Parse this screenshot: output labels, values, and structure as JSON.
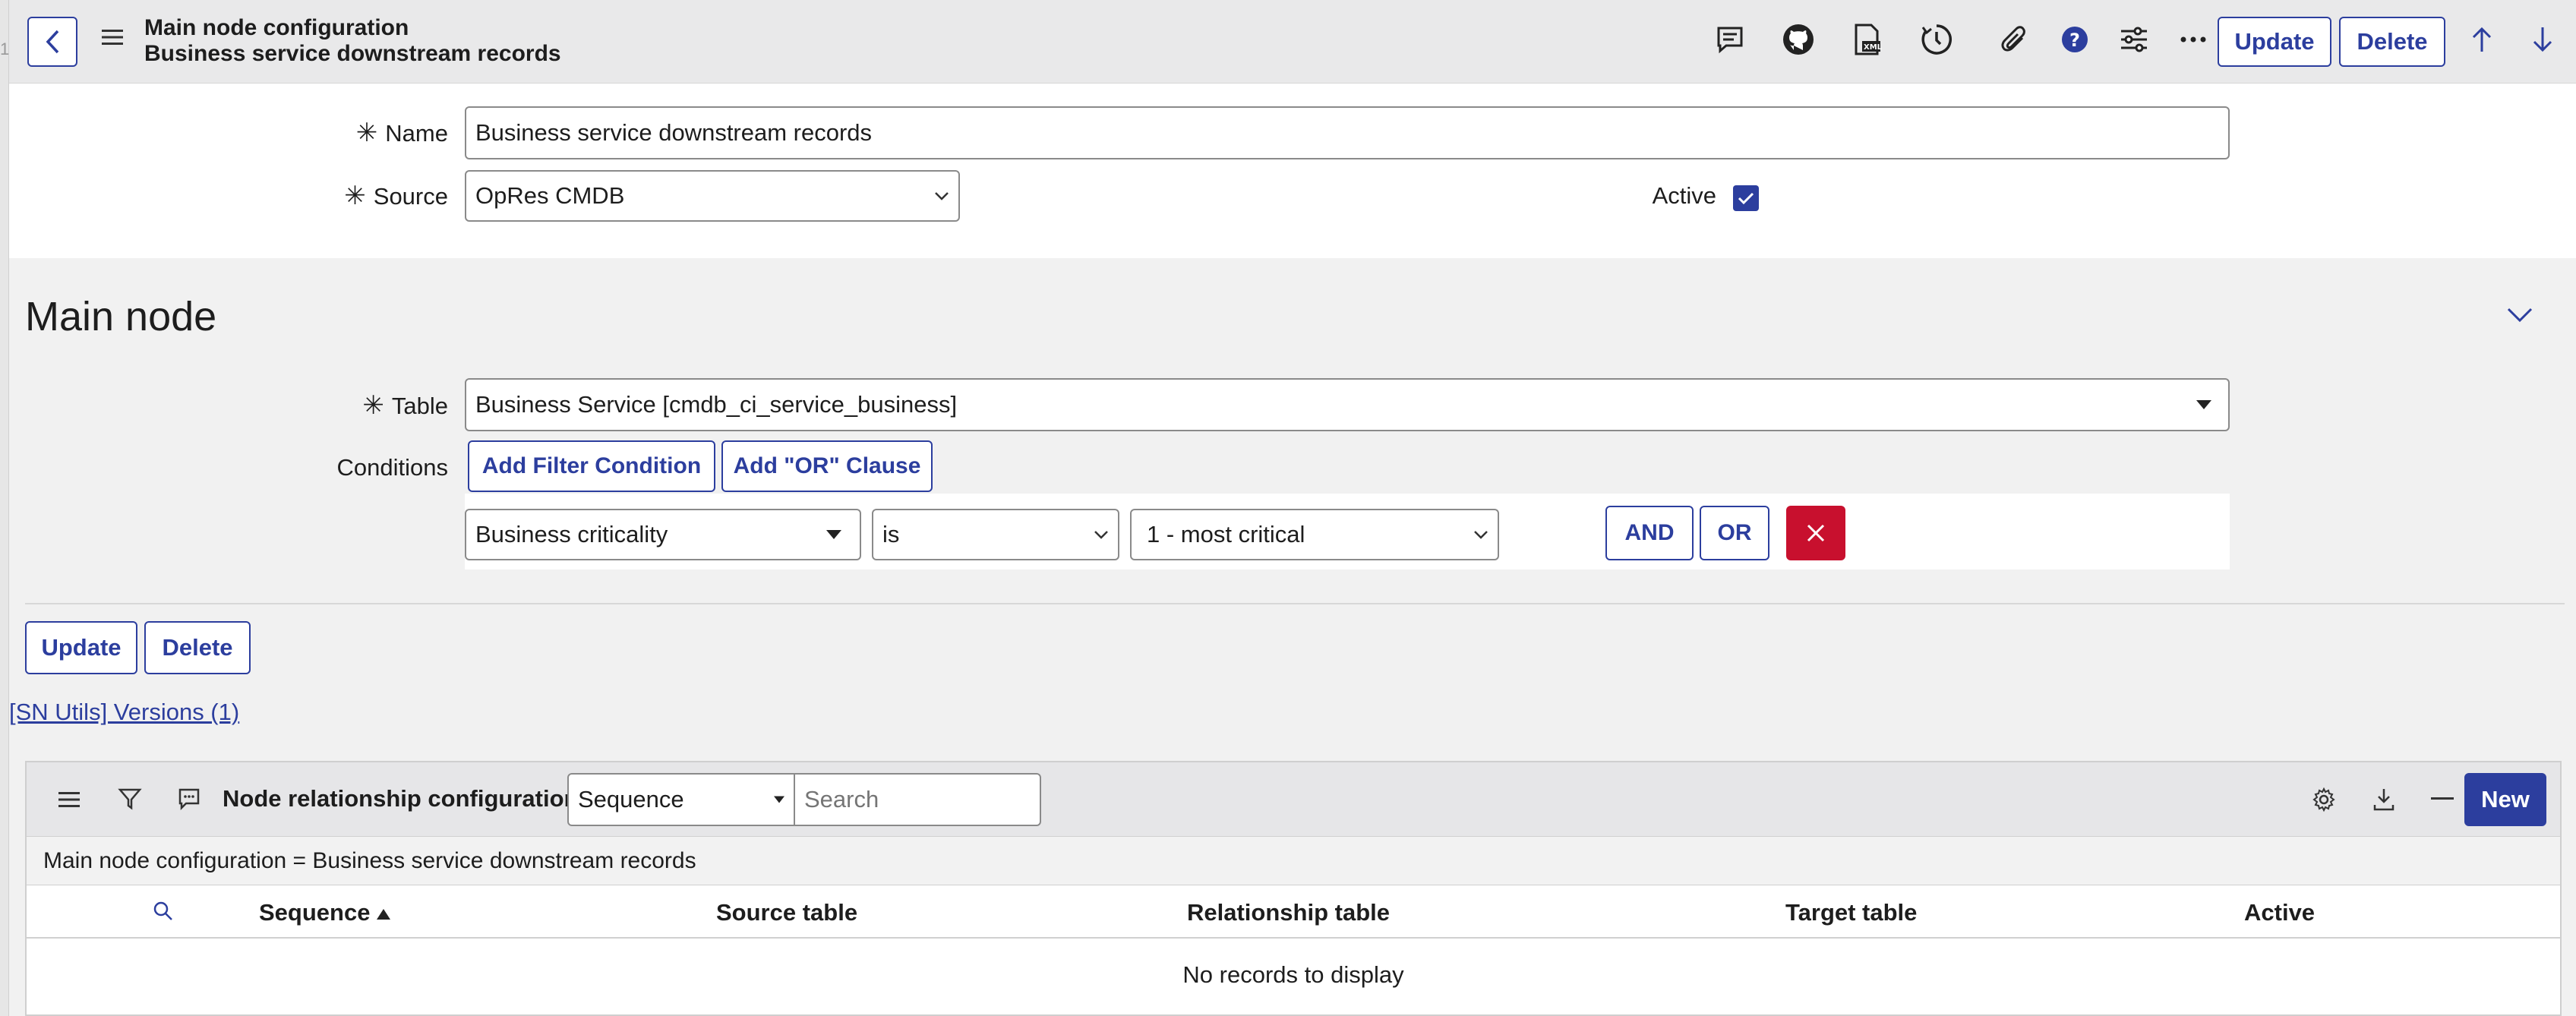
{
  "gutter": {
    "number": "1"
  },
  "header": {
    "title_line1": "Main node configuration",
    "title_line2": "Business service downstream records",
    "update_label": "Update",
    "delete_label": "Delete",
    "icons": [
      "back-icon",
      "hamburger-menu-icon",
      "comment-icon",
      "github-icon",
      "xml-icon",
      "history-icon",
      "paperclip-icon",
      "help-icon",
      "settings-sliders-icon",
      "more-icon",
      "arrow-up-icon",
      "arrow-down-icon"
    ]
  },
  "form": {
    "name_label": "Name",
    "name_value": "Business service downstream records",
    "source_label": "Source",
    "source_value": "OpRes CMDB",
    "active_label": "Active",
    "active_checked": true
  },
  "main_node": {
    "section_title": "Main node",
    "table_label": "Table",
    "table_value": "Business Service [cmdb_ci_service_business]",
    "conditions_label": "Conditions",
    "add_filter_label": "Add Filter Condition",
    "add_or_label": "Add \"OR\" Clause",
    "condition": {
      "field": "Business criticality",
      "operator": "is",
      "value": "1 - most critical"
    },
    "and_label": "AND",
    "or_label": "OR"
  },
  "bottom_buttons": {
    "update_label": "Update",
    "delete_label": "Delete"
  },
  "related_link": "[SN Utils] Versions (1)",
  "related_list": {
    "title": "Node relationship configurations",
    "search_field": "Sequence",
    "search_placeholder": "Search",
    "new_label": "New",
    "filter_text": "Main node configuration = Business service downstream records",
    "columns": [
      "Sequence",
      "Source table",
      "Relationship table",
      "Target table",
      "Active"
    ],
    "empty_message": "No records to display"
  },
  "colors": {
    "accent": "#2c3e9e",
    "danger": "#c8102e"
  }
}
